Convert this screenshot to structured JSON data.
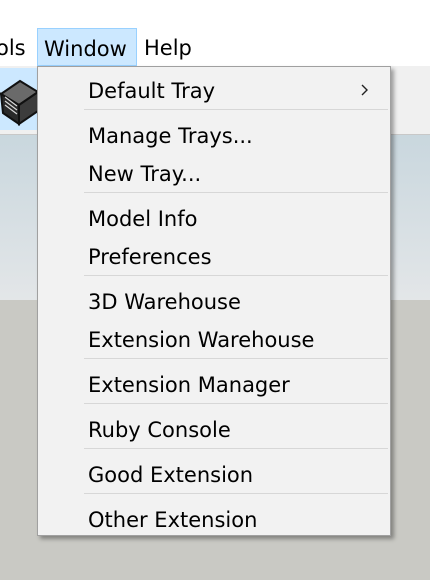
{
  "menubar": {
    "items": [
      {
        "label": "ols"
      },
      {
        "label": "Window"
      },
      {
        "label": "Help"
      }
    ]
  },
  "toolbar": {
    "icons": [
      "dark-box-icon"
    ]
  },
  "window_menu": {
    "items": [
      {
        "label": "Default Tray",
        "has_submenu": true
      },
      {
        "label": "Manage Trays..."
      },
      {
        "label": "New Tray..."
      },
      {
        "label": "Model Info"
      },
      {
        "label": "Preferences"
      },
      {
        "label": "3D Warehouse"
      },
      {
        "label": "Extension Warehouse"
      },
      {
        "label": "Extension Manager"
      },
      {
        "label": "Ruby Console"
      },
      {
        "label": "Good Extension"
      },
      {
        "label": "Other Extension"
      }
    ]
  },
  "colors": {
    "menu_highlight": "#cce8ff",
    "menu_background": "#f2f2f2",
    "viewport_ground": "#c9c9c4"
  }
}
